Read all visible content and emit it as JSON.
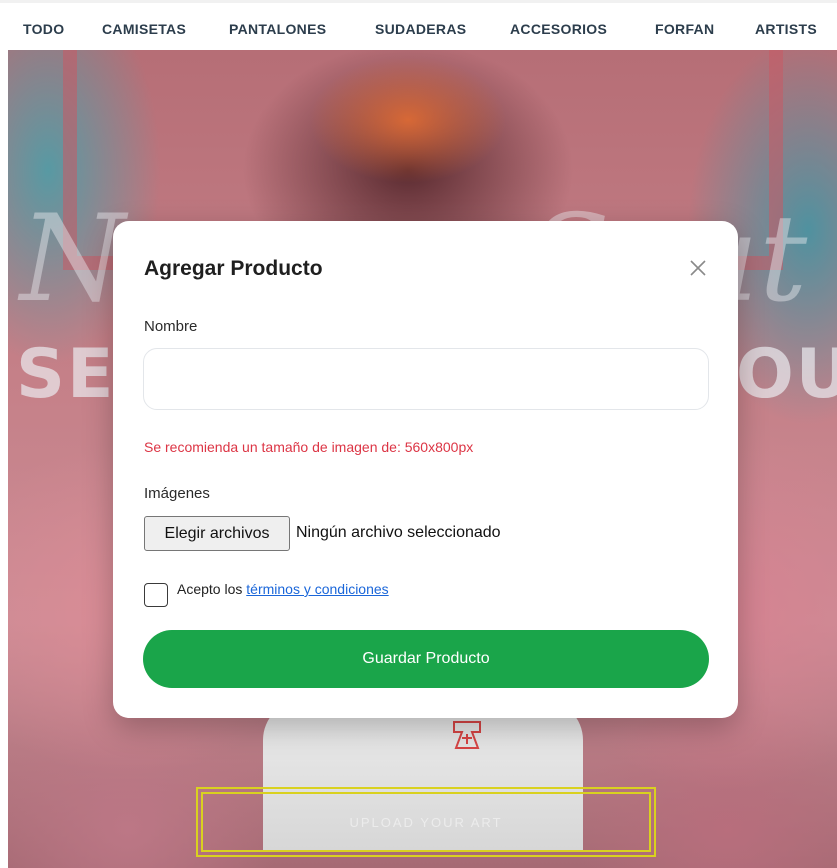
{
  "nav": {
    "items": [
      "TODO",
      "CAMISETAS",
      "PANTALONES",
      "SUDADERAS",
      "ACCESORIOS",
      "FORFAN",
      "ARTISTS"
    ]
  },
  "hero": {
    "script_left": "N",
    "script_right": "Saut",
    "big_left": "SE",
    "big_right": "OU",
    "upload_label": "UPLOAD YOUR ART"
  },
  "modal": {
    "title": "Agregar Producto",
    "close_icon": "close-x-icon",
    "name_label": "Nombre",
    "name_value": "",
    "name_placeholder": "",
    "image_size_warning": "Se recomienda un tamaño de imagen de: 560x800px",
    "images_label": "Imágenes",
    "file_button_label": "Elegir archivos",
    "file_status": "Ningún archivo seleccionado",
    "terms_prefix": "Acepto los ",
    "terms_link": "términos y condiciones",
    "terms_checked": false,
    "save_label": "Guardar Producto"
  },
  "colors": {
    "save_button": "#1aa54a",
    "warning_text": "#dc3545",
    "link": "#1a66d9",
    "nav_text": "#2c3d4c",
    "upload_border": "#d9d11f"
  }
}
